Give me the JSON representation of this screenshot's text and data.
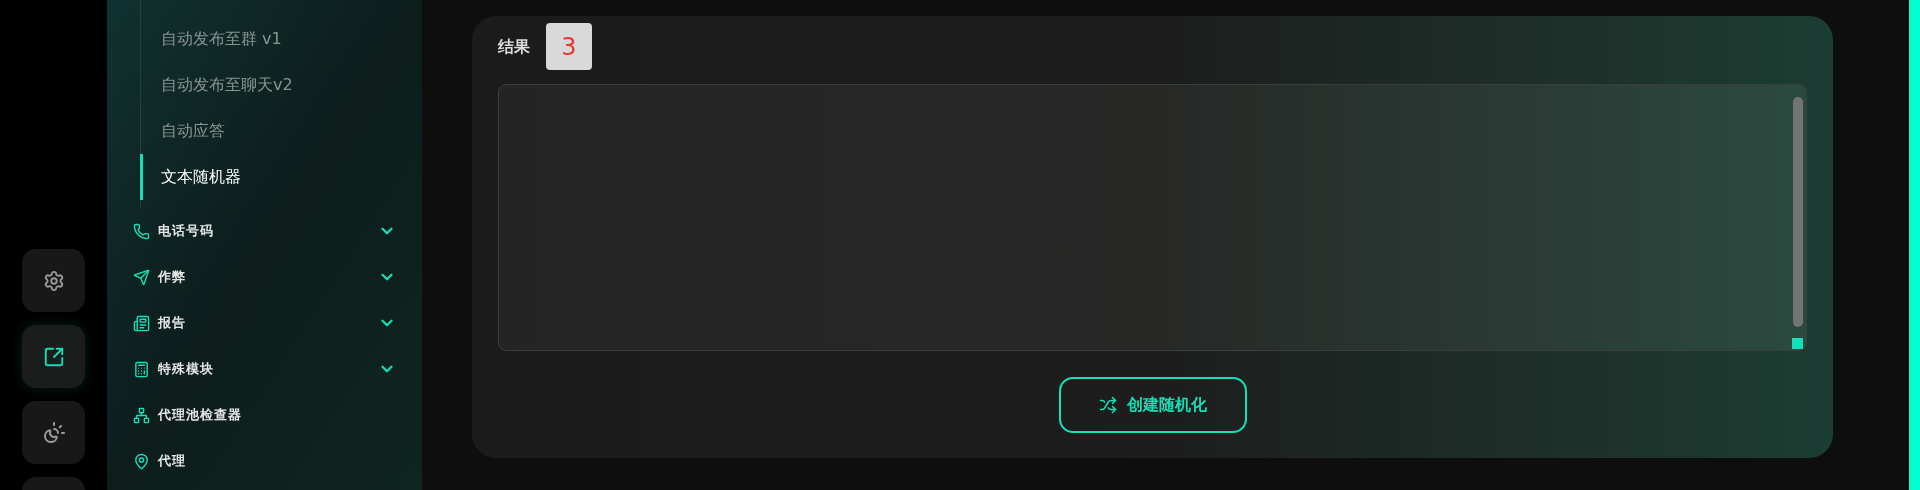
{
  "rail": [
    {
      "kind": "settings",
      "selected": false
    },
    {
      "kind": "open-link",
      "selected": true
    },
    {
      "kind": "theme",
      "selected": false
    },
    {
      "kind": "blank",
      "selected": false
    }
  ],
  "submenu": [
    {
      "label": "自动发布至群 v1",
      "selected": false
    },
    {
      "label": "自动发布至聊天v2",
      "selected": false
    },
    {
      "label": "自动应答",
      "selected": false
    },
    {
      "label": "文本随机器",
      "selected": true
    }
  ],
  "sections": [
    {
      "label": "电话号码",
      "kind": "phone",
      "expandable": true
    },
    {
      "label": "作弊",
      "kind": "send",
      "expandable": true
    },
    {
      "label": "报告",
      "kind": "report",
      "expandable": true
    },
    {
      "label": "特殊模块",
      "kind": "table",
      "expandable": true
    },
    {
      "label": "代理池检查器",
      "kind": "network",
      "expandable": false
    },
    {
      "label": "代理",
      "kind": "pin",
      "expandable": false
    }
  ],
  "result": {
    "label": "结果",
    "badge": "3"
  },
  "button": {
    "label": "创建随机化"
  }
}
